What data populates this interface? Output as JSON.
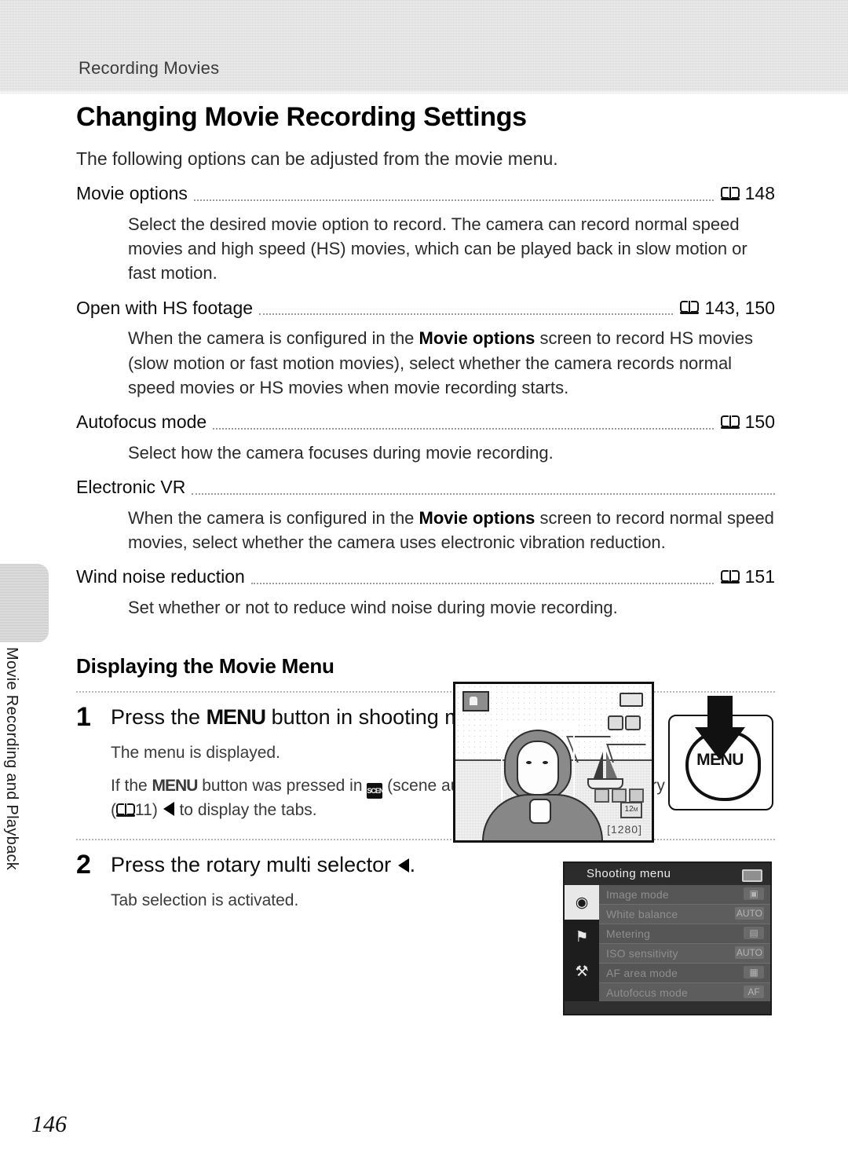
{
  "header": {
    "running_head": "Recording Movies"
  },
  "side_tab": {
    "label": "Movie Recording and Playback"
  },
  "page": {
    "title": "Changing Movie Recording Settings",
    "intro": "The following options can be adjusted from the movie menu.",
    "number": "146"
  },
  "options": [
    {
      "name": "Movie options",
      "page_ref": "148",
      "description_parts": [
        {
          "text": "Select the desired movie option to record. The camera can record normal speed movies and high speed (HS) movies, which can be played back in slow motion or fast motion.",
          "bold": false
        }
      ],
      "description_plain": "Select the desired movie option to record. The camera can record normal speed movies and high speed (HS) movies, which can be played back in slow motion or fast motion."
    },
    {
      "name": "Open with HS footage",
      "page_ref": "143, 150",
      "description_parts": [
        {
          "text": "When the camera is configured in the ",
          "bold": false
        },
        {
          "text": "Movie options",
          "bold": true
        },
        {
          "text": " screen to record HS movies (slow motion or fast motion movies), select whether the camera records normal speed movies or HS movies when movie recording starts.",
          "bold": false
        }
      ],
      "description_plain": "When the camera is configured in the Movie options screen to record HS movies (slow motion or fast motion movies), select whether the camera records normal speed movies or HS movies when movie recording starts."
    },
    {
      "name": "Autofocus mode",
      "page_ref": "150",
      "description_parts": [
        {
          "text": "Select how the camera focuses during movie recording.",
          "bold": false
        }
      ],
      "description_plain": "Select how the camera focuses during movie recording."
    },
    {
      "name": "Electronic VR",
      "page_ref": "",
      "description_parts": [
        {
          "text": "When the camera is configured in the ",
          "bold": false
        },
        {
          "text": "Movie options",
          "bold": true
        },
        {
          "text": " screen to record normal speed movies, select whether the camera uses electronic vibration reduction.",
          "bold": false
        }
      ],
      "description_plain": "When the camera is configured in the Movie options screen to record normal speed movies, select whether the camera uses electronic vibration reduction."
    },
    {
      "name": "Wind noise reduction",
      "page_ref": "151",
      "description_parts": [
        {
          "text": "Set whether or not to reduce wind noise during movie recording.",
          "bold": false
        }
      ],
      "description_plain": "Set whether or not to reduce wind noise during movie recording."
    }
  ],
  "subsection": {
    "title": "Displaying the Movie Menu"
  },
  "steps": [
    {
      "number": "1",
      "title_parts": [
        {
          "text": "Press the ",
          "style": "normal"
        },
        {
          "text": "MENU",
          "style": "menu"
        },
        {
          "text": " button in shooting mode.",
          "style": "normal"
        }
      ],
      "title_plain": "Press the MENU button in shooting mode.",
      "texts": [
        "The menu is displayed.",
        "If the MENU button was pressed in ⊠ (scene auto selector), press the rotary multi selector (⎕ 11) ◀ to display the tabs."
      ],
      "text1": "The menu is displayed.",
      "text2_a": "If the ",
      "text2_menu": "MENU",
      "text2_b": " button was pressed in ",
      "text2_scene_glyph": "SCENE",
      "text2_c": " (scene auto selector), press the rotary multi selector (",
      "text2_pageref": "11",
      "text2_d": ") ",
      "text2_e": " to display the tabs."
    },
    {
      "number": "2",
      "title_parts": [
        {
          "text": "Press the rotary multi selector ",
          "style": "normal"
        },
        {
          "text": "◀",
          "style": "arrow"
        },
        {
          "text": ".",
          "style": "normal"
        }
      ],
      "title_plain": "Press the rotary multi selector ◀.",
      "title_a": "Press the rotary multi selector ",
      "title_b": ".",
      "texts": [
        "Tab selection is activated."
      ],
      "text1": "Tab selection is activated."
    }
  ],
  "figures": {
    "lcd_screen": {
      "mode_icon": "scene-auto-selector-icon",
      "battery_icon": "battery-full-icon",
      "shots_remaining": "[1280]",
      "image_size": "12",
      "image_size_unit": "M"
    },
    "menu_button": {
      "label": "MENU",
      "arrow": "down-arrow-icon"
    },
    "shooting_menu": {
      "title": "Shooting menu",
      "tabs": [
        {
          "name": "shooting-tab",
          "glyph": "◉",
          "active": true
        },
        {
          "name": "movie-tab",
          "glyph": "⚑",
          "active": false
        },
        {
          "name": "setup-tab",
          "glyph": "⚒",
          "active": false
        }
      ],
      "rows": [
        {
          "label": "Image mode",
          "value": "▣"
        },
        {
          "label": "White balance",
          "value": "AUTO"
        },
        {
          "label": "Metering",
          "value": "▤"
        },
        {
          "label": "ISO sensitivity",
          "value": "AUTO"
        },
        {
          "label": "AF area mode",
          "value": "▦"
        },
        {
          "label": "Autofocus mode",
          "value": "AF"
        }
      ]
    }
  },
  "colors": {
    "header_band": "#d4d4d4",
    "thumb_tab": "#c9c9c9",
    "text": "#1a1a1a",
    "leader": "#9a9a9a",
    "menu_screen_bg": "#3c3c3c"
  }
}
